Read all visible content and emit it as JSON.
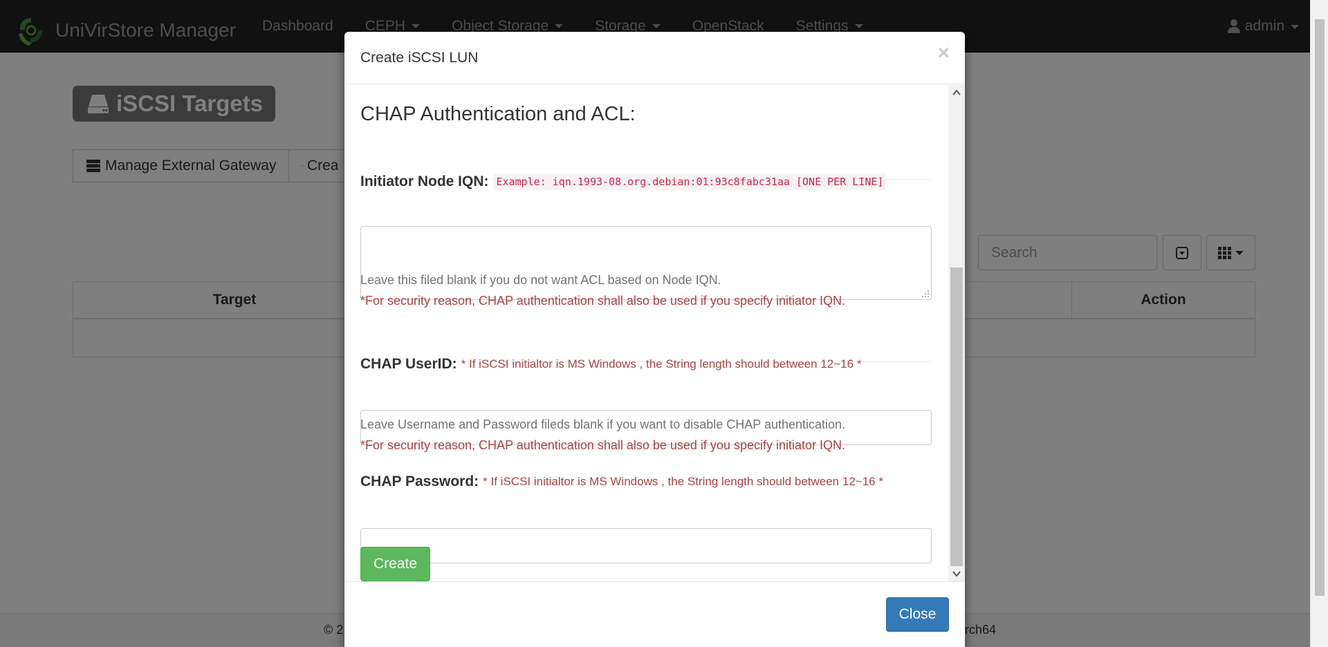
{
  "navbar": {
    "brand": "UniVirStore Manager",
    "items": [
      {
        "label": "Dashboard",
        "dropdown": false
      },
      {
        "label": "CEPH",
        "dropdown": true
      },
      {
        "label": "Object Storage",
        "dropdown": true
      },
      {
        "label": "Storage",
        "dropdown": true
      },
      {
        "label": "OpenStack",
        "dropdown": false
      },
      {
        "label": "Settings",
        "dropdown": true
      }
    ],
    "user": "admin"
  },
  "page": {
    "title": "iSCSI Targets",
    "buttons": {
      "manage_gateway": "Manage External Gateway",
      "create_partial": "Crea"
    },
    "search_placeholder": "Search",
    "table_headers": {
      "target": "Target",
      "action": "Action"
    },
    "footer": {
      "copyright_partial": "© 2",
      "arch_partial": "arch64"
    }
  },
  "modal": {
    "title": "Create iSCSI LUN",
    "close_x": "×",
    "section_title": "CHAP Authentication and ACL:",
    "initiator": {
      "label": "Initiator Node IQN:",
      "example": "Example: iqn.1993-08.org.debian:01:93c8fabc31aa [ONE PER LINE]",
      "help": "Leave this filed blank if you do not want ACL based on Node IQN.",
      "warning": "*For security reason, CHAP authentication shall also be used if you specify initiator IQN."
    },
    "chap_userid": {
      "label": "CHAP UserID:",
      "hint": "* If iSCSI initialtor is MS Windows , the String length should between 12~16 *",
      "value": "",
      "help": "Leave Username and Password fileds blank if you want to disable CHAP authentication.",
      "warning": "*For security reason, CHAP authentication shall also be used if you specify initiator IQN."
    },
    "chap_password": {
      "label": "CHAP Password:",
      "hint": "* If iSCSI initialtor is MS Windows , the String length should between 12~16 *",
      "value": ""
    },
    "create_button": "Create",
    "close_button": "Close"
  },
  "colors": {
    "navbar_bg": "#222222",
    "primary": "#337ab7",
    "success": "#5cb85c",
    "danger_text": "#a94442",
    "code_text": "#c7254e"
  }
}
